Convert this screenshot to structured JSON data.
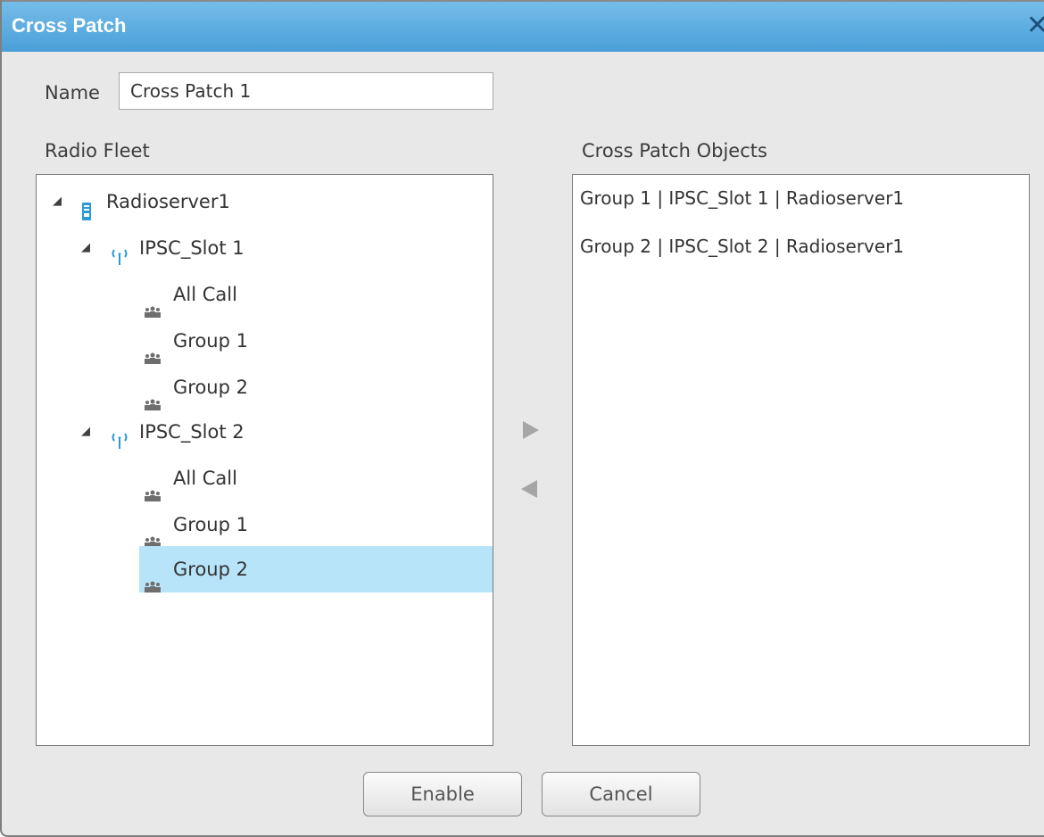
{
  "window": {
    "title": "Cross Patch",
    "close_glyph": "✕"
  },
  "name_field": {
    "label": "Name",
    "value": "Cross Patch 1"
  },
  "radio_fleet": {
    "label": "Radio Fleet",
    "server": "Radioserver1",
    "slot1": {
      "label": "IPSC_Slot 1",
      "items": [
        "All Call",
        "Group 1",
        "Group 2"
      ]
    },
    "slot2": {
      "label": "IPSC_Slot 2",
      "items": [
        "All Call",
        "Group 1",
        "Group 2"
      ]
    },
    "selected": "IPSC_Slot 2 / Group 2"
  },
  "cross_patch_objects": {
    "label": "Cross Patch Objects",
    "items": [
      "Group 1 | IPSC_Slot 1 | Radioserver1",
      "Group 2 | IPSC_Slot 2 | Radioserver1"
    ]
  },
  "buttons": {
    "enable": "Enable",
    "cancel": "Cancel"
  },
  "icons": {
    "server": "server-icon",
    "slot": "antenna-icon",
    "group": "group-icon",
    "expand": "expand-triangle-icon",
    "add": "move-right-icon",
    "remove": "move-left-icon"
  },
  "colors": {
    "title_bar": "#4a9fd8",
    "selection": "#b8e4fa",
    "icon_blue": "#2a9ad6",
    "group_icon": "#6e6e6e"
  }
}
